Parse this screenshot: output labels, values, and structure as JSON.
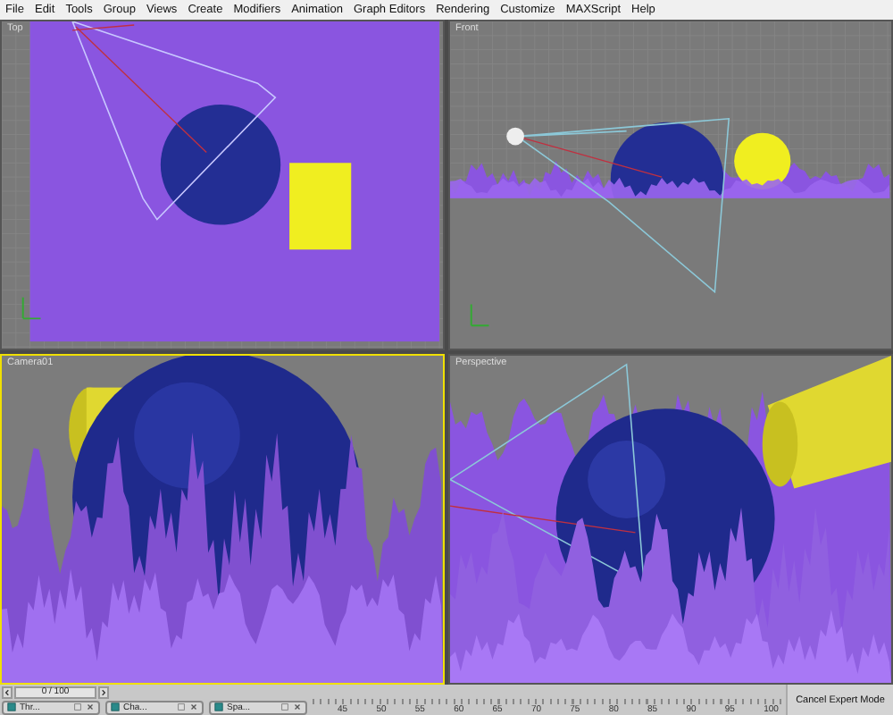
{
  "menu": [
    "File",
    "Edit",
    "Tools",
    "Group",
    "Views",
    "Create",
    "Modifiers",
    "Animation",
    "Graph Editors",
    "Rendering",
    "Customize",
    "MAXScript",
    "Help"
  ],
  "viewports": [
    {
      "label": "Top",
      "kind": "top",
      "selected": false
    },
    {
      "label": "Front",
      "kind": "front",
      "selected": false
    },
    {
      "label": "Camera01",
      "kind": "camera",
      "selected": true
    },
    {
      "label": "Perspective",
      "kind": "perspective",
      "selected": false
    }
  ],
  "time_slider": {
    "label": "0 / 100"
  },
  "taskbar": [
    "Thr...",
    "Cha...",
    "Spa..."
  ],
  "ruler_ticks": [
    "45",
    "50",
    "55",
    "60",
    "65",
    "70",
    "75",
    "80",
    "85",
    "90",
    "95",
    "100"
  ],
  "expert_button": "Cancel Expert Mode"
}
